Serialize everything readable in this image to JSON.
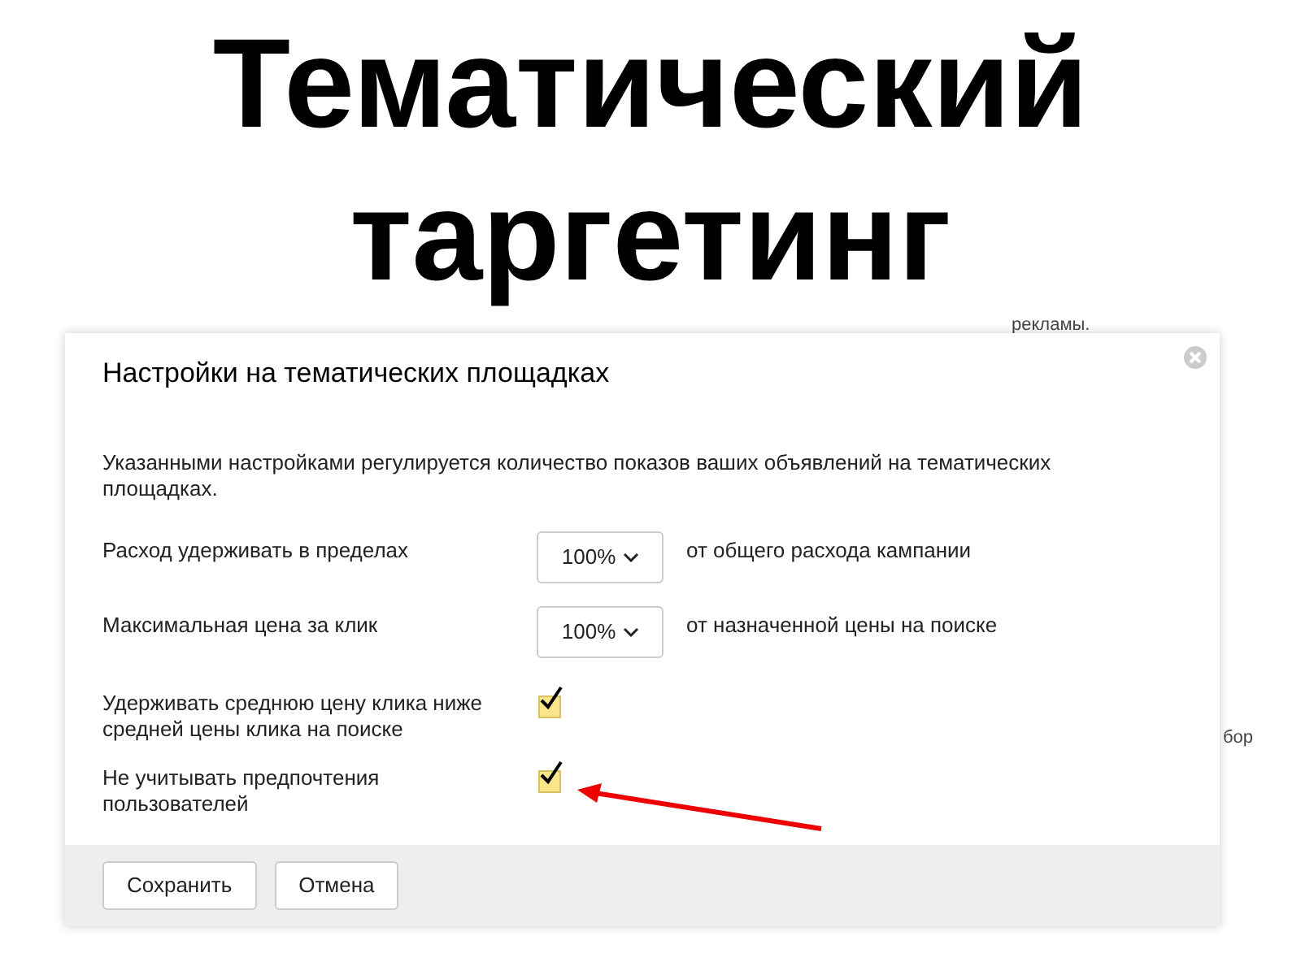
{
  "slide_title": [
    "Тематический",
    "таргетинг"
  ],
  "background_fragments": [
    "рекламы.",
    "бор"
  ],
  "dialog": {
    "title": "Настройки на тематических площадках",
    "description": "Указанными настройками регулируется количество показов ваших объявлений на тематических площадках.",
    "settings": [
      {
        "kind": "select",
        "label": "Расход удерживать в пределах",
        "value": "100%",
        "suffix": "от общего расхода кампании"
      },
      {
        "kind": "select",
        "label": "Максимальная цена за клик",
        "value": "100%",
        "suffix": "от назначенной цены на поиске"
      },
      {
        "kind": "checkbox",
        "label": "Удерживать среднюю цену клика ниже средней цены клика на поиске",
        "checked": true
      },
      {
        "kind": "checkbox",
        "label": "Не учитывать предпочтения пользователей",
        "checked": true
      }
    ],
    "buttons": [
      "Сохранить",
      "Отмена"
    ]
  }
}
